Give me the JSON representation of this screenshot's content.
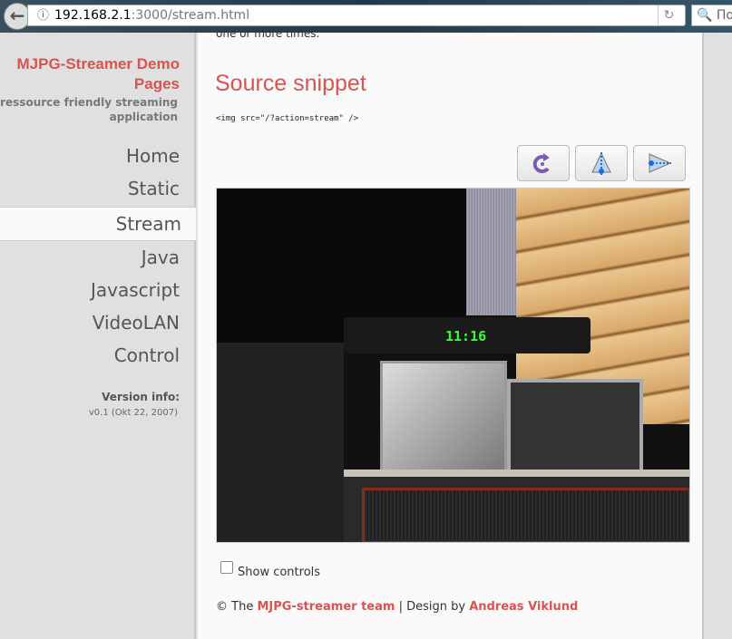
{
  "browser": {
    "url_host": "192.168.2.1",
    "url_rest": ":3000/stream.html",
    "search_placeholder": "По"
  },
  "sidebar": {
    "title": "MJPG-Streamer Demo Pages",
    "subtitle": "a ressource friendly streaming application",
    "items": [
      {
        "label": "Home"
      },
      {
        "label": "Static"
      },
      {
        "label": "Stream",
        "active": true
      },
      {
        "label": "Java"
      },
      {
        "label": "Javascript"
      },
      {
        "label": "VideoLAN"
      },
      {
        "label": "Control"
      }
    ],
    "version_label": "Version info:",
    "version_value": "v0.1 (Okt 22, 2007)"
  },
  "main": {
    "clipped_text": "one or more times.",
    "heading": "Source snippet",
    "code": "<img src=\"/?action=stream\" />",
    "buttons": [
      {
        "icon": "rotate-icon"
      },
      {
        "icon": "flip-vertical-icon"
      },
      {
        "icon": "flip-horizontal-icon"
      }
    ],
    "show_controls_label": "Show controls",
    "show_controls_checked": false,
    "footer": {
      "prefix": "© The",
      "team": "MJPG-streamer team",
      "sep": " | Design by ",
      "designer": "Andreas Viklund"
    },
    "camera_clock": "11:16"
  }
}
